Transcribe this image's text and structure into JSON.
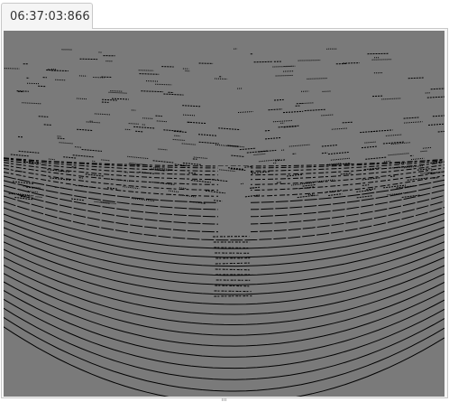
{
  "tab": {
    "timestamp": "06:37:03:866"
  },
  "viewport": {
    "content": "lidar-point-cloud",
    "background_color": "#7a7a7a",
    "point_color": "#000000"
  }
}
